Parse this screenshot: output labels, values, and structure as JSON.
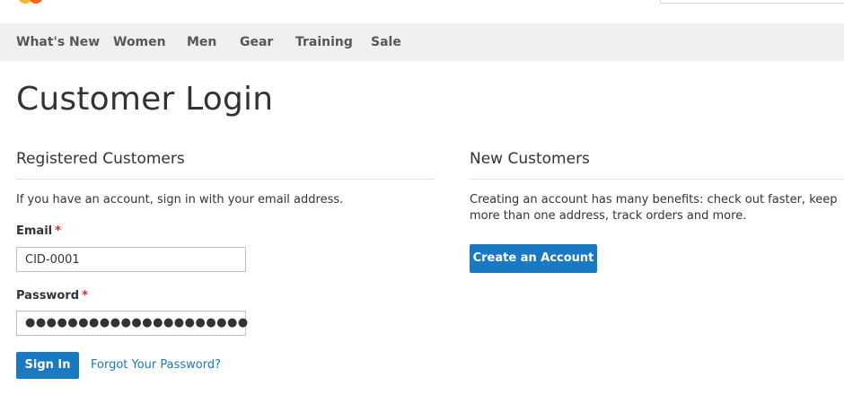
{
  "header": {
    "logo_icon": "luma-logo-icon",
    "brand_colors": {
      "orange": "#f26322",
      "yellow": "#f6b829"
    }
  },
  "nav": {
    "items": [
      {
        "label": "What's New"
      },
      {
        "label": "Women"
      },
      {
        "label": "Men"
      },
      {
        "label": "Gear"
      },
      {
        "label": "Training"
      },
      {
        "label": "Sale"
      }
    ]
  },
  "page": {
    "title": "Customer Login"
  },
  "registered": {
    "title": "Registered Customers",
    "note": "If you have an account, sign in with your email address.",
    "email_label": "Email",
    "email_value": "CID-0001",
    "password_label": "Password",
    "password_dots": "●●●●●●●●●●●●●●●●●●●●●",
    "required_marker": "*",
    "sign_in_label": "Sign In",
    "forgot_label": "Forgot Your Password?"
  },
  "new_customers": {
    "title": "New Customers",
    "note": "Creating an account has many benefits: check out faster, keep more than one address, track orders and more.",
    "create_label": "Create an Account"
  },
  "colors": {
    "primary": "#1979c3",
    "required": "#e02b27",
    "nav_bg": "#f0f0f0"
  }
}
